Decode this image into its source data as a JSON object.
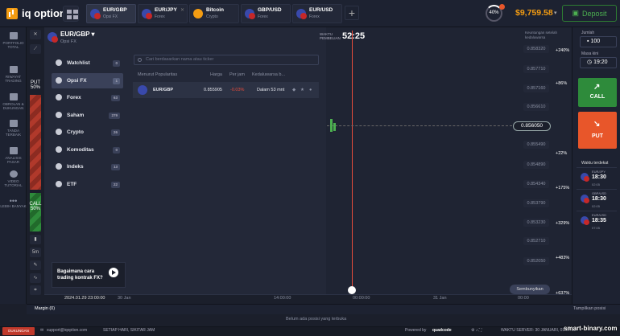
{
  "brand": {
    "name": "iq option"
  },
  "tabs": [
    {
      "pair": "EUR/GBP",
      "type": "Opsi FX"
    },
    {
      "pair": "EUR/JPY",
      "type": "Forex"
    },
    {
      "pair": "Bitcoin",
      "type": "Crypto"
    },
    {
      "pair": "GBP/USD",
      "type": "Forex"
    },
    {
      "pair": "EUR/USD",
      "type": "Forex"
    }
  ],
  "header": {
    "bonus_pct": "40%",
    "balance": "$9,759.58",
    "deposit": "Deposit"
  },
  "leftnav": [
    {
      "label": "PORTFOLIO TOTAL"
    },
    {
      "label": "RIWAYAT TRADING"
    },
    {
      "label": "OBROLAN & DUKUNGAN"
    },
    {
      "label": "TANDA TERBAIK"
    },
    {
      "label": "ANALISIS PASAR"
    },
    {
      "label": "VIDEO TUTORIAL"
    },
    {
      "label": "LEBIH BANYAK"
    }
  ],
  "sentiment": {
    "put_label": "PUT",
    "put_pct": "50%",
    "call_label": "CALL",
    "call_pct": "50%"
  },
  "tools": [
    "5m"
  ],
  "asset": {
    "pair": "EUR/GBP",
    "type": "Opsi FX"
  },
  "categories": [
    {
      "label": "Watchlist",
      "count": "0"
    },
    {
      "label": "Opsi FX",
      "count": "1"
    },
    {
      "label": "Forex",
      "count": "63"
    },
    {
      "label": "Saham",
      "count": "279"
    },
    {
      "label": "Crypto",
      "count": "26"
    },
    {
      "label": "Komoditas",
      "count": "0"
    },
    {
      "label": "Indeks",
      "count": "13"
    },
    {
      "label": "ETF",
      "count": "22"
    }
  ],
  "search": {
    "placeholder": "Cari berdasarkan nama atau ticker"
  },
  "table": {
    "headers": [
      "Menurut Popularitas",
      "Harga",
      "Per jam",
      "Kedaluwarsa b..."
    ],
    "rows": [
      {
        "pair": "EUR/GBP",
        "price": "0.855905",
        "change": "-0.03%",
        "expiry": "Dalam 53 mnt"
      }
    ]
  },
  "promo": {
    "text": "Bagaimana cara trading kontrak FX?"
  },
  "chart": {
    "expiry_label": "WAKTU PEMBELIAN",
    "timer": "52:25",
    "current_price": "0.856050",
    "price_ticks": [
      "0.858320",
      "0.857710",
      "0.857160",
      "0.856610",
      "0.855490",
      "0.854890",
      "0.854340",
      "0.853790",
      "0.853230",
      "0.852710",
      "0.852050"
    ],
    "pct_ticks": [
      "+240%",
      "+86%",
      "+22%",
      "+175%",
      "+329%",
      "+483%",
      "+637%"
    ],
    "notice": "Keuntungan setelah kedaluwarsa",
    "hide": "Sembunyikan"
  },
  "timeaxis": [
    "2024.01.29 23:00:00",
    "30 Jan",
    "14:00:00",
    "00:00:00",
    "31 Jan",
    "00:00"
  ],
  "right": {
    "amount_label": "Jumlah",
    "amount": "100",
    "time_label": "Masa kini",
    "time": "19:20",
    "call": "CALL",
    "put": "PUT",
    "deadline_label": "Waktu terdekat",
    "deadlines": [
      {
        "pair": "EUR/JPY",
        "time": "18:30",
        "sub": "02:05"
      },
      {
        "pair": "GBP/USD",
        "time": "18:30",
        "sub": "02:05"
      },
      {
        "pair": "EUR/USD",
        "time": "18:35",
        "sub": "07:05"
      }
    ]
  },
  "bottom": {
    "margin": "Margin (0)",
    "show_all": "Tampilkan posisi",
    "no_positions": "Belum ada posisi yang terbuka",
    "support_badge": "DUKUNGAN",
    "support_email": "support@iqoption.com",
    "hours": "SETIAP HARI, SIKITAR JAM",
    "powered": "Powered by",
    "quadcode": "quadcode",
    "server_time": "WAKTU SERVER: 30 JANUARI, 01:07:13",
    "watermark": "smart-binary.com"
  }
}
